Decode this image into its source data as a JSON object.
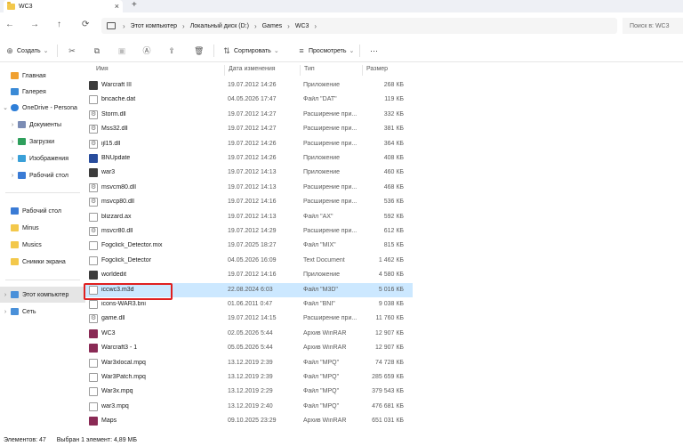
{
  "window": {
    "tab_title": "WC3",
    "close_glyph": "×",
    "newtab_glyph": "+"
  },
  "nav": {
    "back": "←",
    "forward": "→",
    "up": "↑",
    "refresh": "⟳"
  },
  "address": {
    "parts": [
      "Этот компьютер",
      "Локальный диск (D:)",
      "Games",
      "WC3"
    ],
    "separator": "›"
  },
  "search": {
    "placeholder": "Поиск в: WC3"
  },
  "toolbar": {
    "create_label": "Создать",
    "sort_label": "Сортировать",
    "view_label": "Просмотреть",
    "more_label": "···"
  },
  "sidebar": {
    "items": [
      {
        "label": "Главная",
        "icon": "home-icon"
      },
      {
        "label": "Галерея",
        "icon": "gallery-icon"
      },
      {
        "label": "OneDrive - Persona",
        "icon": "cloud-icon"
      },
      {
        "label": "Документы",
        "icon": "documents-icon"
      },
      {
        "label": "Загрузки",
        "icon": "downloads-icon"
      },
      {
        "label": "Изображения",
        "icon": "pictures-icon"
      },
      {
        "label": "Рабочий стол",
        "icon": "desktop-icon"
      },
      {
        "label": "Рабочий стол",
        "icon": "desktop-icon"
      },
      {
        "label": "Minus",
        "icon": "folder-icon"
      },
      {
        "label": "Musics",
        "icon": "folder-icon"
      },
      {
        "label": "Снимки экрана",
        "icon": "folder-icon"
      },
      {
        "label": "Этот компьютер",
        "icon": "computer-icon"
      },
      {
        "label": "Сеть",
        "icon": "network-icon"
      }
    ]
  },
  "columns": {
    "name": "Имя",
    "date": "Дата изменения",
    "type": "Тип",
    "size": "Размер"
  },
  "files": [
    {
      "name": "Warcraft III",
      "date": "19.07.2012 14:26",
      "type": "Приложение",
      "size": "268 КБ"
    },
    {
      "name": "bncache.dat",
      "date": "04.05.2026 17:47",
      "type": "Файл \"DAT\"",
      "size": "119 КБ"
    },
    {
      "name": "Storm.dll",
      "date": "19.07.2012 14:27",
      "type": "Расширение при...",
      "size": "332 КБ"
    },
    {
      "name": "Mss32.dll",
      "date": "19.07.2012 14:27",
      "type": "Расширение при...",
      "size": "381 КБ"
    },
    {
      "name": "ijl15.dll",
      "date": "19.07.2012 14:26",
      "type": "Расширение при...",
      "size": "364 КБ"
    },
    {
      "name": "BNUpdate",
      "date": "19.07.2012 14:26",
      "type": "Приложение",
      "size": "408 КБ"
    },
    {
      "name": "war3",
      "date": "19.07.2012 14:13",
      "type": "Приложение",
      "size": "460 КБ"
    },
    {
      "name": "msvcm80.dll",
      "date": "19.07.2012 14:13",
      "type": "Расширение при...",
      "size": "468 КБ"
    },
    {
      "name": "msvcp80.dll",
      "date": "19.07.2012 14:16",
      "type": "Расширение при...",
      "size": "536 КБ"
    },
    {
      "name": "blizzard.ax",
      "date": "19.07.2012 14:13",
      "type": "Файл \"AX\"",
      "size": "592 КБ"
    },
    {
      "name": "msvcr80.dll",
      "date": "19.07.2012 14:29",
      "type": "Расширение при...",
      "size": "612 КБ"
    },
    {
      "name": "Fogclick_Detector.mix",
      "date": "19.07.2025 18:27",
      "type": "Файл \"MIX\"",
      "size": "815 КБ"
    },
    {
      "name": "Fogclick_Detector",
      "date": "04.05.2026 16:09",
      "type": "Text Document",
      "size": "1 462 КБ"
    },
    {
      "name": "worldedit",
      "date": "19.07.2012 14:16",
      "type": "Приложение",
      "size": "4 580 КБ"
    },
    {
      "name": "iccwc3.m3d",
      "date": "22.08.2024 6:03",
      "type": "Файл \"M3D\"",
      "size": "5 016 КБ"
    },
    {
      "name": "icons-WAR3.bni",
      "date": "01.06.2011 0:47",
      "type": "Файл \"BNI\"",
      "size": "9 038 КБ"
    },
    {
      "name": "game.dll",
      "date": "19.07.2012 14:15",
      "type": "Расширение при...",
      "size": "11 760 КБ"
    },
    {
      "name": "WC3",
      "date": "02.05.2026 5:44",
      "type": "Архив WinRAR",
      "size": "12 907 КБ"
    },
    {
      "name": "Warcraft3 - 1",
      "date": "05.05.2026 5:44",
      "type": "Архив WinRAR",
      "size": "12 907 КБ"
    },
    {
      "name": "War3xlocal.mpq",
      "date": "13.12.2019 2:39",
      "type": "Файл \"MPQ\"",
      "size": "74 728 КБ"
    },
    {
      "name": "War3Patch.mpq",
      "date": "13.12.2019 2:39",
      "type": "Файл \"MPQ\"",
      "size": "285 659 КБ"
    },
    {
      "name": "War3x.mpq",
      "date": "13.12.2019 2:29",
      "type": "Файл \"MPQ\"",
      "size": "379 543 КБ"
    },
    {
      "name": "war3.mpq",
      "date": "13.12.2019 2:40",
      "type": "Файл \"MPQ\"",
      "size": "476 681 КБ"
    },
    {
      "name": "Maps",
      "date": "09.10.2025 23:29",
      "type": "Архив WinRAR",
      "size": "651 031 КБ"
    }
  ],
  "selected_index": 14,
  "status": {
    "count": "Элементов: 47",
    "selection": "Выбран 1 элемент: 4,89 МБ"
  }
}
